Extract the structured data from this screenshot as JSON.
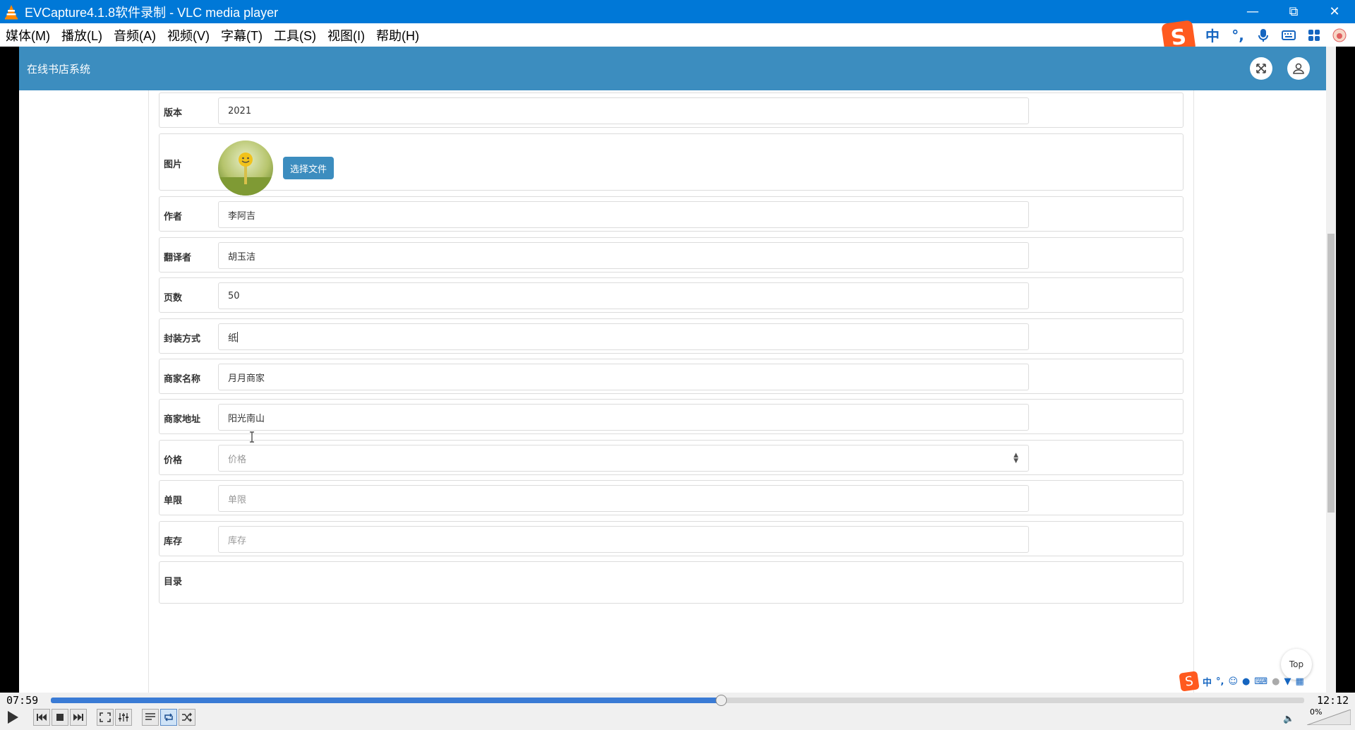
{
  "window": {
    "title": "EVCapture4.1.8软件录制 - VLC media player"
  },
  "menu": [
    {
      "label": "媒体(M)"
    },
    {
      "label": "播放(L)"
    },
    {
      "label": "音频(A)"
    },
    {
      "label": "视频(V)"
    },
    {
      "label": "字幕(T)"
    },
    {
      "label": "工具(S)"
    },
    {
      "label": "视图(I)"
    },
    {
      "label": "帮助(H)"
    }
  ],
  "ime": {
    "lang": "中",
    "punct": "°,"
  },
  "app": {
    "title": "在线书店系统"
  },
  "form": {
    "edition": {
      "label": "版本",
      "value": "2021"
    },
    "image": {
      "label": "图片",
      "button": "选择文件"
    },
    "author": {
      "label": "作者",
      "value": "李阿吉"
    },
    "translator": {
      "label": "翻译者",
      "value": "胡玉洁"
    },
    "pages": {
      "label": "页数",
      "value": "50"
    },
    "binding": {
      "label": "封装方式",
      "value": "纸"
    },
    "merchant_name": {
      "label": "商家名称",
      "value": "月月商家"
    },
    "merchant_address": {
      "label": "商家地址",
      "value": "阳光南山"
    },
    "price": {
      "label": "价格",
      "placeholder": "价格"
    },
    "limit": {
      "label": "单限",
      "placeholder": "单限"
    },
    "stock": {
      "label": "库存",
      "placeholder": "库存"
    },
    "catalog": {
      "label": "目录"
    }
  },
  "top_button": "Top",
  "player": {
    "elapsed": "07:59",
    "total": "12:12",
    "progress": 0.535,
    "volume_label": "0%"
  }
}
